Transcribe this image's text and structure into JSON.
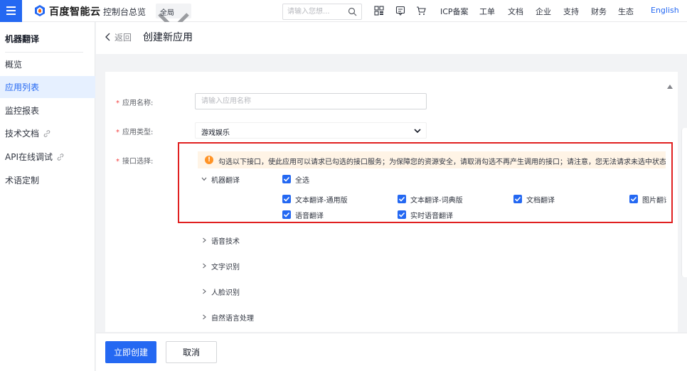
{
  "topbar": {
    "brand": "百度智能云",
    "console": "控制台总览",
    "region": "全局",
    "search_placeholder": "请输入您想...",
    "nav": [
      "ICP备案",
      "工单",
      "文档",
      "企业",
      "支持",
      "财务",
      "生态"
    ],
    "english": "English"
  },
  "sidebar": {
    "title": "机器翻译",
    "items": [
      {
        "label": "概览"
      },
      {
        "label": "应用列表"
      },
      {
        "label": "监控报表"
      },
      {
        "label": "技术文档"
      },
      {
        "label": "API在线调试"
      },
      {
        "label": "术语定制"
      }
    ],
    "active_index": 1
  },
  "header": {
    "back": "返回",
    "title": "创建新应用"
  },
  "form": {
    "name_label": "应用名称:",
    "name_placeholder": "请输入应用名称",
    "name_value": "",
    "type_label": "应用类型:",
    "type_value": "游戏娱乐",
    "api_label": "接口选择:",
    "notice": "勾选以下接口，使此应用可以请求已勾选的接口服务；为保障您的资源安全，请取消勾选不再产生调用的接口；请注意，您无法请求未选中状态的接口",
    "groups": [
      {
        "name": "机器翻译",
        "expanded": true
      },
      {
        "name": "语音技术",
        "expanded": false
      },
      {
        "name": "文字识别",
        "expanded": false
      },
      {
        "name": "人脸识别",
        "expanded": false
      },
      {
        "name": "自然语言处理",
        "expanded": false
      }
    ],
    "select_all": "全选",
    "apis": [
      {
        "label": "文本翻译-通用版",
        "checked": true
      },
      {
        "label": "文本翻译-词典版",
        "checked": true
      },
      {
        "label": "文档翻译",
        "checked": true
      },
      {
        "label": "图片翻译",
        "checked": true
      },
      {
        "label": "语音翻译",
        "checked": true
      },
      {
        "label": "实时语音翻译",
        "checked": true
      }
    ]
  },
  "footer": {
    "create": "立即创建",
    "cancel": "取消"
  },
  "colors": {
    "accent": "#2468f2",
    "highlight_border": "#e02020",
    "warning": "#ff9326",
    "required": "#f33e3e"
  }
}
